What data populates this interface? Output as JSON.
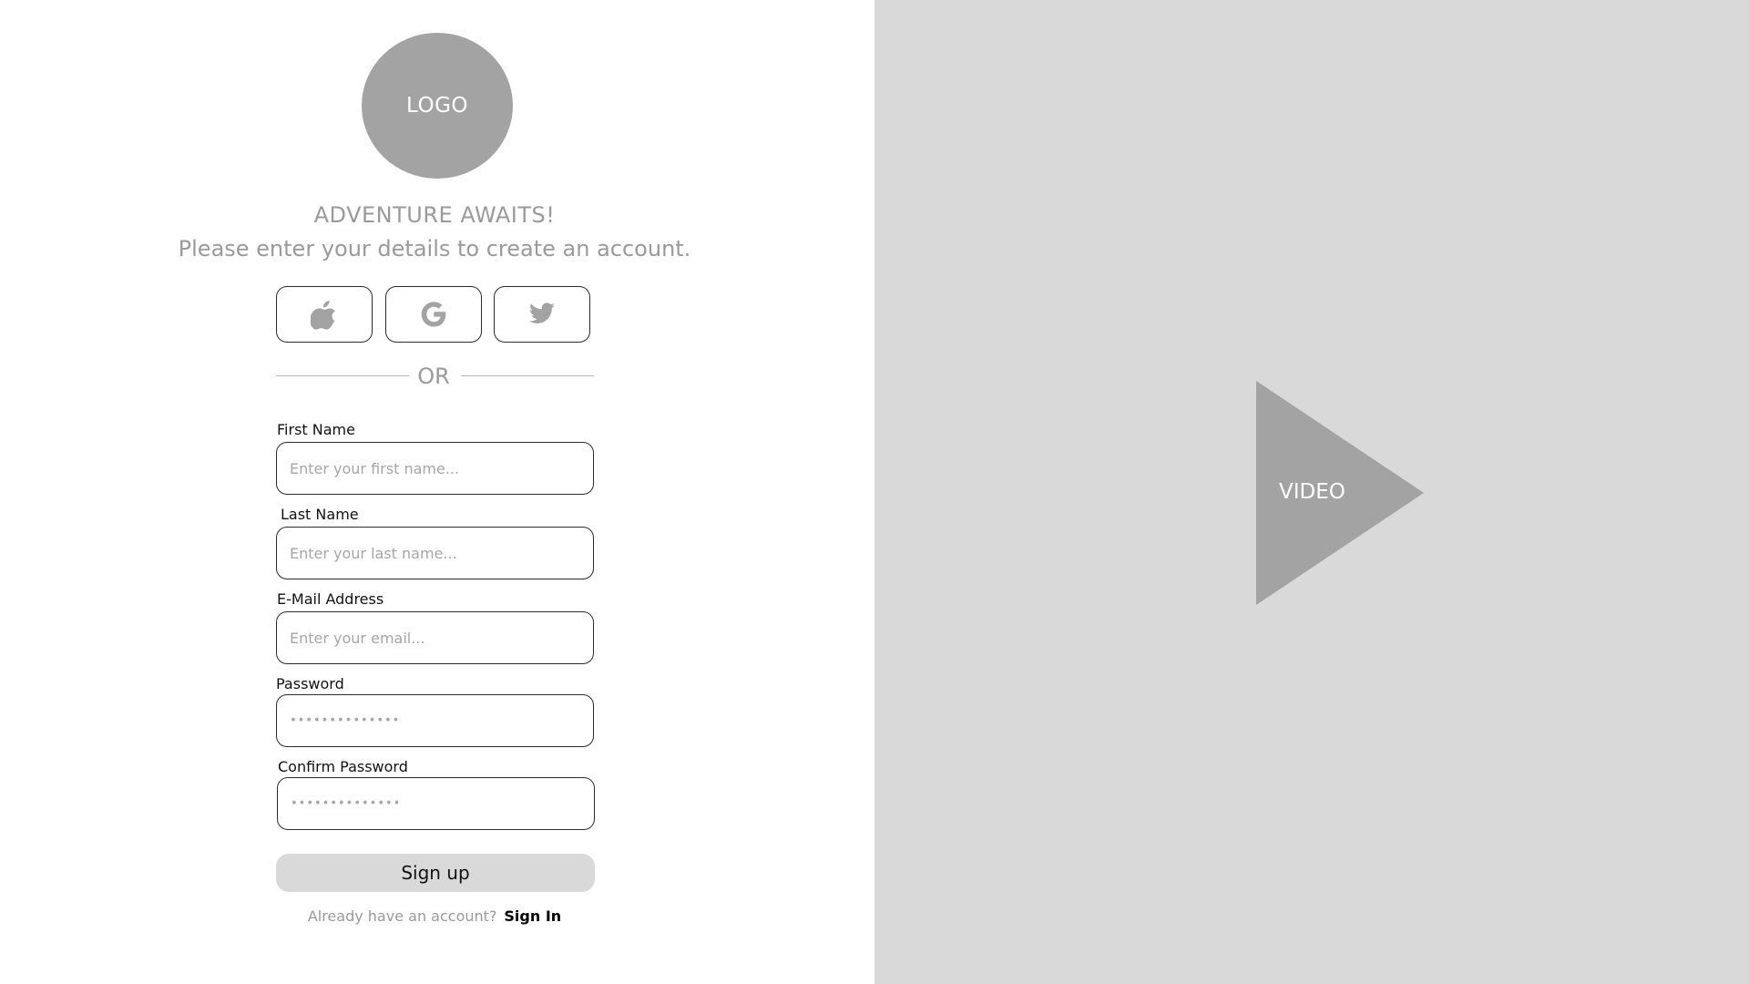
{
  "logo": {
    "text": "LOGO"
  },
  "header": {
    "title": "ADVENTURE AWAITS!",
    "subtitle": "Please enter your details to create an account."
  },
  "social": {
    "buttons": [
      {
        "icon": "apple-icon"
      },
      {
        "icon": "google-icon"
      },
      {
        "icon": "twitter-icon"
      }
    ]
  },
  "divider": {
    "text": "OR"
  },
  "form": {
    "first_name": {
      "label": "First Name",
      "placeholder": "Enter your first name..."
    },
    "last_name": {
      "label": "Last Name",
      "placeholder": "Enter your last name..."
    },
    "email": {
      "label": "E-Mail Address",
      "placeholder": "Enter your email..."
    },
    "password": {
      "label": "Password",
      "masked": "••••••••••••••"
    },
    "confirm_password": {
      "label": "Confirm Password",
      "masked": "••••••••••••••"
    },
    "submit_label": "Sign up"
  },
  "signin": {
    "prompt": "Already have an account?",
    "link": "Sign In"
  },
  "video": {
    "label": "VIDEO"
  },
  "colors": {
    "panel_gray": "#d9d9d9",
    "placeholder_gray": "#a3a3a3",
    "text_gray": "#9a9a9a",
    "border_dark": "#2b2b2b"
  }
}
